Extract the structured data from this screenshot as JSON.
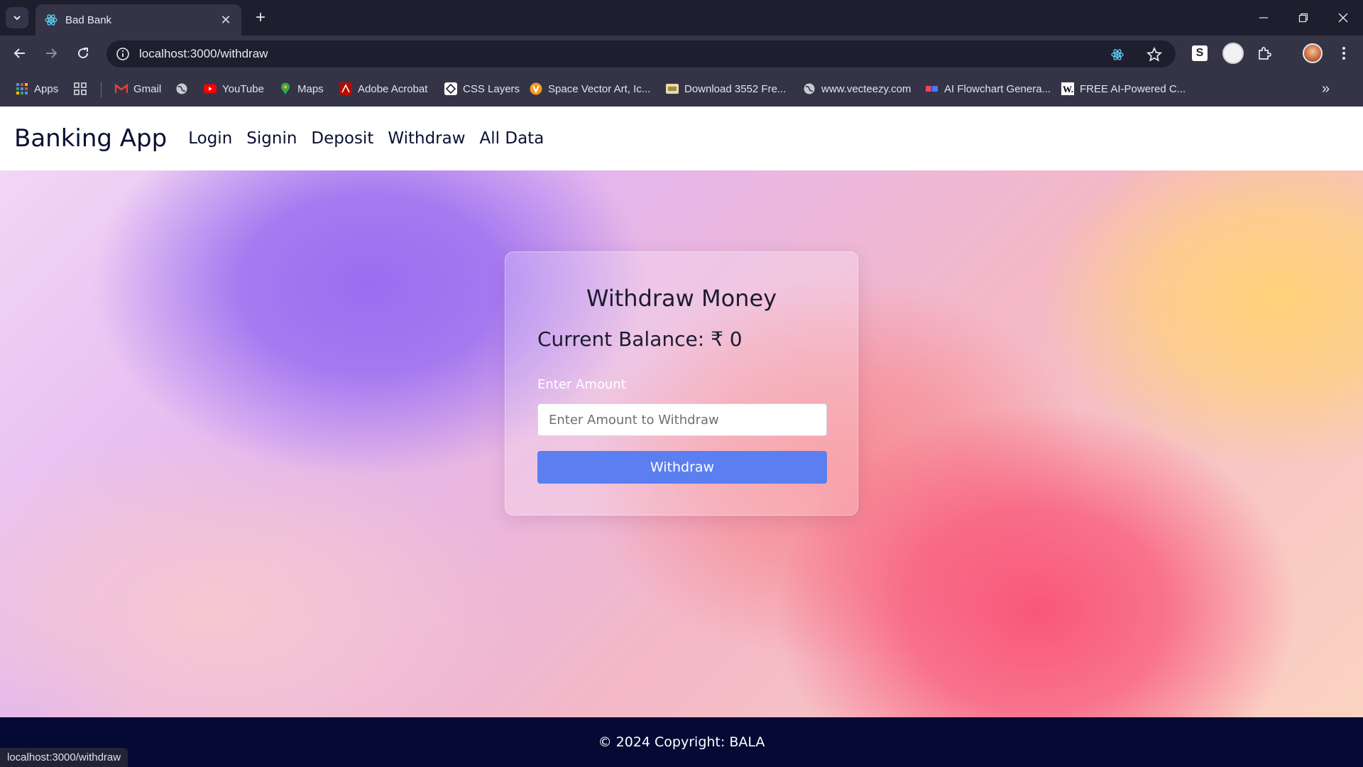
{
  "browser": {
    "tab": {
      "title": "Bad Bank",
      "favicon": "react-icon"
    },
    "url": "localhost:3000/withdraw",
    "status_url": "localhost:3000/withdraw",
    "bookmarks": [
      {
        "label": "Apps",
        "icon": "apps-grid-icon"
      },
      {
        "label": "",
        "icon": "app-launcher-icon"
      },
      {
        "label": "Gmail",
        "icon": "gmail-icon"
      },
      {
        "label": "",
        "icon": "globe-icon"
      },
      {
        "label": "YouTube",
        "icon": "youtube-icon"
      },
      {
        "label": "Maps",
        "icon": "maps-pin-icon"
      },
      {
        "label": "Adobe Acrobat",
        "icon": "acrobat-icon"
      },
      {
        "label": "CSS Layers",
        "icon": "css-layers-icon"
      },
      {
        "label": "Space Vector Art, Ic...",
        "icon": "vecteezy-icon"
      },
      {
        "label": "Download 3552 Fre...",
        "icon": "image-icon"
      },
      {
        "label": "www.vecteezy.com",
        "icon": "globe-icon"
      },
      {
        "label": "AI Flowchart Genera...",
        "icon": "flowchart-icon"
      },
      {
        "label": "FREE AI-Powered C...",
        "icon": "w-icon"
      }
    ]
  },
  "app": {
    "brand": "Banking App",
    "nav": [
      "Login",
      "Signin",
      "Deposit",
      "Withdraw",
      "All Data"
    ],
    "card": {
      "title": "Withdraw Money",
      "balance": "Current Balance: ₹ 0",
      "amount_label": "Enter Amount",
      "amount_placeholder": "Enter Amount to Withdraw",
      "amount_value": "",
      "button_label": "Withdraw"
    },
    "footer": "© 2024 Copyright: BALA"
  },
  "colors": {
    "nav_text": "#0b1033",
    "button": "#5b7ff0",
    "footer_bg": "#050a35",
    "chrome_dark": "#1f1e2f",
    "chrome_mid": "#353447"
  }
}
